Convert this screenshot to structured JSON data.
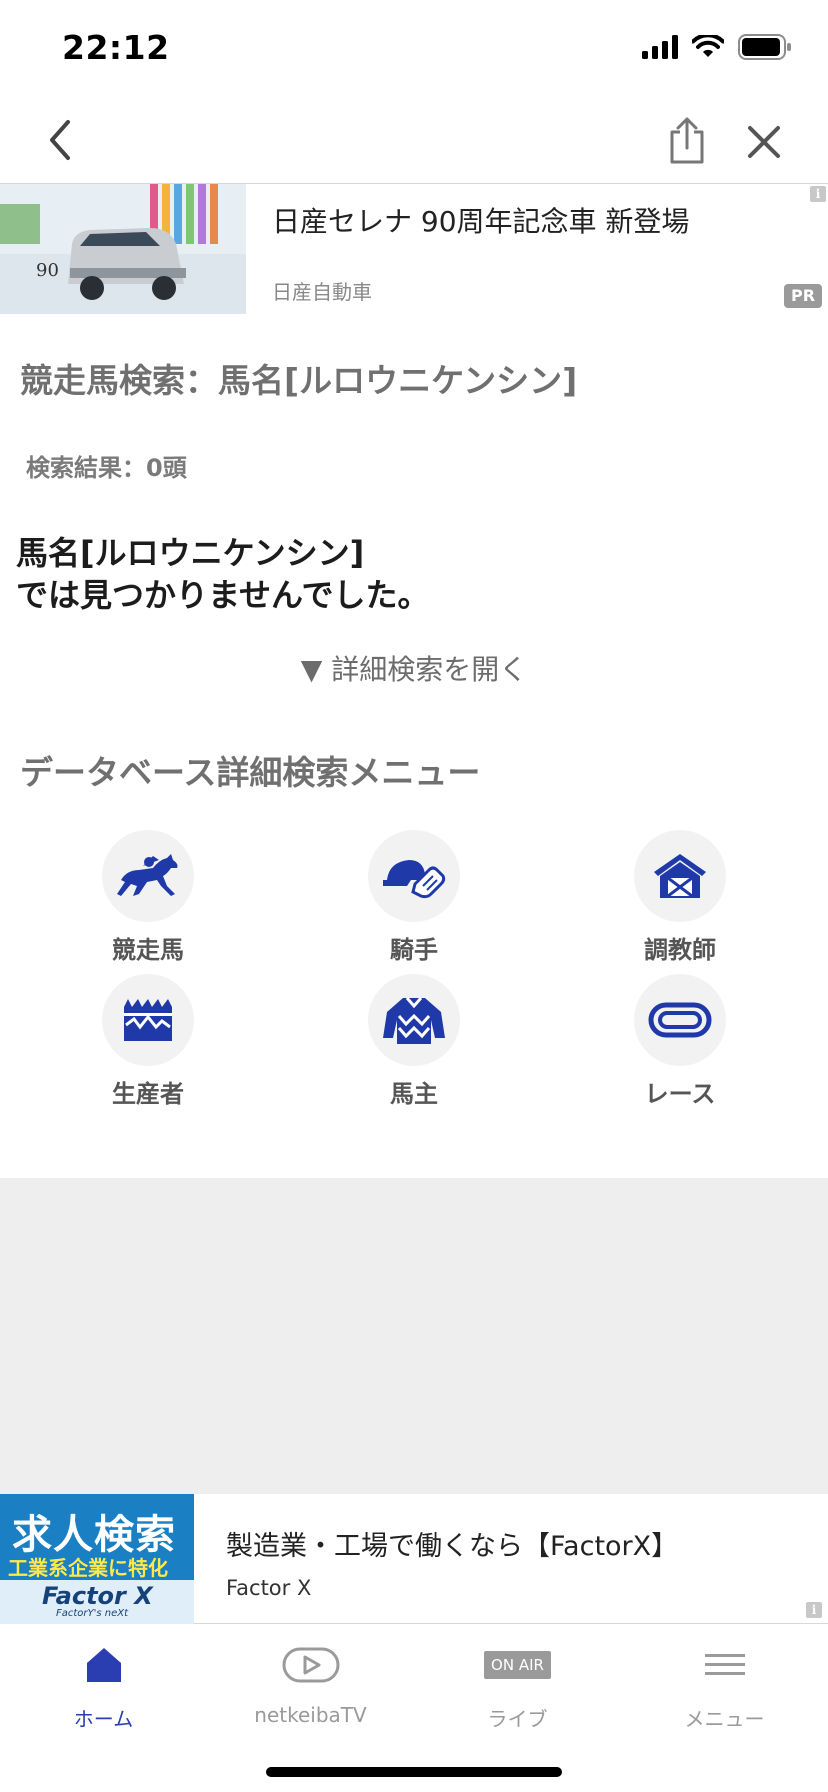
{
  "status_bar": {
    "time": "22:12"
  },
  "top_ad": {
    "title": "日産セレナ 90周年記念車 新登場",
    "sponsor": "日産自動車",
    "pr_badge": "PR",
    "info_badge": "i",
    "thumb_mark": "90"
  },
  "page": {
    "heading": "競走馬検索：馬名[ルロウニケンシン]",
    "result_count": "検索結果：0頭",
    "notfound_line1": "馬名[ルロウニケンシン]",
    "notfound_line2": "では見つかりませんでした。",
    "detail_toggle": "▼ 詳細検索を開く",
    "db_heading": "データベース詳細検索メニュー"
  },
  "db_menu": {
    "items": [
      {
        "label": "競走馬",
        "icon": "racehorse-icon"
      },
      {
        "label": "騎手",
        "icon": "jockey-icon"
      },
      {
        "label": "調教師",
        "icon": "stable-icon"
      },
      {
        "label": "生産者",
        "icon": "farm-icon"
      },
      {
        "label": "馬主",
        "icon": "silks-icon"
      },
      {
        "label": "レース",
        "icon": "racecourse-icon"
      }
    ]
  },
  "bottom_ad": {
    "thumb_line1": "求人検索",
    "thumb_line2": "工業系企業に特化",
    "thumb_brand": "Factor X",
    "thumb_sub": "FactorY's neXt",
    "title": "製造業・工場で働くなら【FactorX】",
    "sponsor": "Factor X",
    "info_badge": "i"
  },
  "tab_bar": {
    "tabs": [
      {
        "label": "ホーム",
        "icon": "home-icon",
        "active": true
      },
      {
        "label": "netkeibaTV",
        "icon": "play-icon",
        "active": false
      },
      {
        "label": "ライブ",
        "icon": "on-air-icon",
        "badge": "ON AIR",
        "active": false
      },
      {
        "label": "メニュー",
        "icon": "menu-icon",
        "active": false
      }
    ]
  },
  "colors": {
    "accent": "#2a3eb1",
    "icon_blue": "#1f3aa8",
    "muted": "#707070"
  }
}
